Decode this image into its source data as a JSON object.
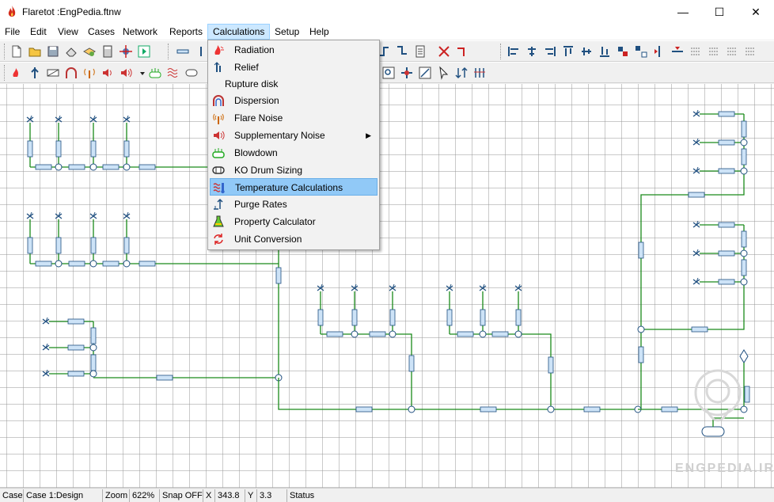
{
  "window": {
    "title": "Flaretot :EngPedia.ftnw",
    "minimize_glyph": "—",
    "maximize_glyph": "☐",
    "close_glyph": "✕"
  },
  "menubar": [
    {
      "label": "File"
    },
    {
      "label": "Edit"
    },
    {
      "label": "View"
    },
    {
      "label": "Cases"
    },
    {
      "label": "Network"
    },
    {
      "label": "Reports"
    },
    {
      "label": "Calculations"
    },
    {
      "label": "Setup"
    },
    {
      "label": "Help"
    }
  ],
  "calculations_menu": [
    {
      "label": "Radiation",
      "icon": "radiation-icon"
    },
    {
      "label": "Relief",
      "icon": "relief-icon"
    },
    {
      "label": "Rupture disk",
      "icon": ""
    },
    {
      "label": "Dispersion",
      "icon": "dispersion-icon"
    },
    {
      "label": "Flare Noise",
      "icon": "flare-noise-icon"
    },
    {
      "label": "Supplementary Noise",
      "icon": "speaker-icon",
      "submenu_arrow": "▶"
    },
    {
      "label": "Blowdown",
      "icon": "blowdown-icon"
    },
    {
      "label": "KO Drum Sizing",
      "icon": "ko-drum-icon"
    },
    {
      "label": "Temperature Calculations",
      "icon": "temperature-icon",
      "highlighted": true
    },
    {
      "label": "Purge Rates",
      "icon": "purge-icon"
    },
    {
      "label": "Property Calculator",
      "icon": "flask-icon"
    },
    {
      "label": "Unit Conversion",
      "icon": "unit-conversion-icon"
    }
  ],
  "statusbar": {
    "case_label": "Case",
    "case_value": "Case 1:Design",
    "zoom_label": "Zoom",
    "zoom_value": "622%",
    "snap": "Snap OFF",
    "x_label": "X",
    "x_value": "343.8",
    "y_label": "Y",
    "y_value": "3.3",
    "status_label": "Status"
  },
  "watermark": "ENGPEDIA.IR",
  "colors": {
    "pipe": "#1a8a1a",
    "node_outline": "#205080",
    "pipe_box": "#cde3f7",
    "menu_highlight": "#91c9f7",
    "menubar_active": "#cce8ff"
  }
}
